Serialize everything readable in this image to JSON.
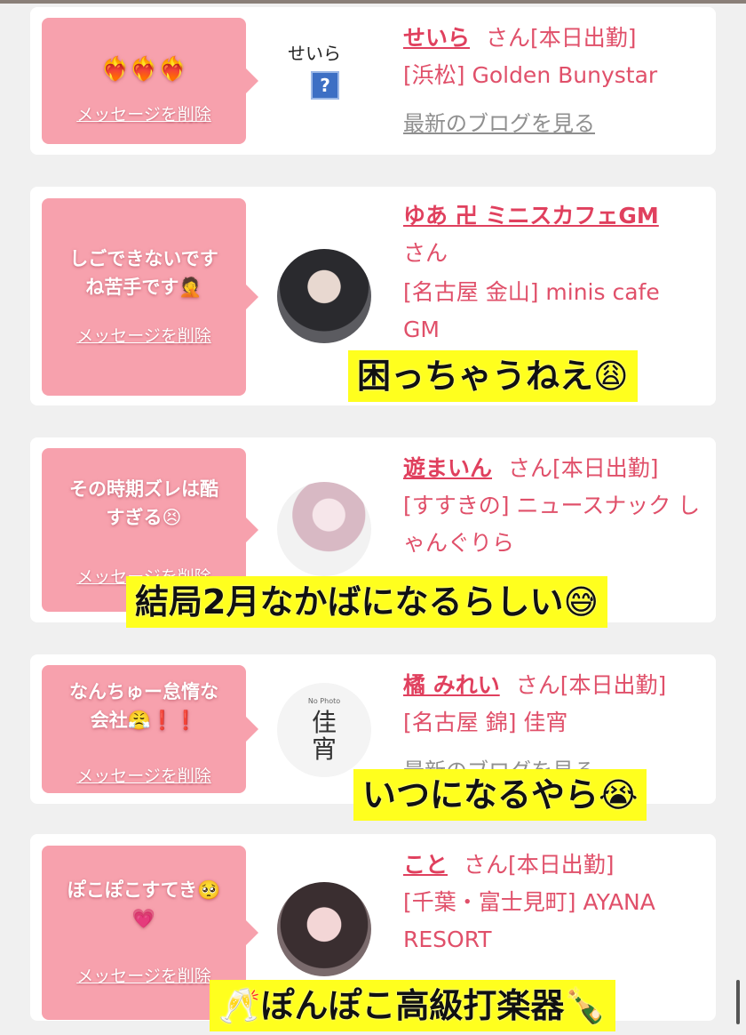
{
  "messages": [
    {
      "text": "❤️‍🔥❤️‍🔥❤️‍🔥",
      "delete_label": "メッセージを削除",
      "avatar_alt": "せいら",
      "name": "せいら",
      "suffix": "さん[本日出勤]",
      "shop": "[浜松] Golden Bunystar",
      "blog": "最新のブログを見る"
    },
    {
      "text": "しごできないです\nね苦手です🤦",
      "delete_label": "メッセージを削除",
      "name": "ゆあ 卍 ミニスカフェGM",
      "suffix": "さん",
      "shop": "[名古屋 金山] minis cafe GM"
    },
    {
      "text": "その時期ズレは酷\nすぎる😣",
      "delete_label": "メッセージを削除",
      "name": "遊まいん",
      "suffix": "さん[本日出勤]",
      "shop": "[すすきの] ニュースナック しゃんぐりら"
    },
    {
      "text": "なんちゅー怠惰な\n会社😤❗❗",
      "delete_label": "メッセージを削除",
      "avatar_text": "佳宵",
      "avatar_small": "No Photo",
      "name": "橘 みれい",
      "suffix": "さん[本日出勤]",
      "shop": "[名古屋 錦] 佳宵",
      "blog": "最新のブログを見る"
    },
    {
      "text": "ぽこぽこすてき🥺\n💗",
      "delete_label": "メッセージを削除",
      "name": "こと",
      "suffix": "さん[本日出勤]",
      "shop": "[千葉・富士見町] AYANA RESORT"
    }
  ],
  "captions": [
    "困っちゃうねえ😩",
    "結局2月なかばになるらしい😅",
    "いつになるやら😭",
    "🥂ぽんぽこ高級打楽器🍾"
  ],
  "colors": {
    "bubble": "#f7a1ad",
    "link": "#e0405e",
    "caption_bg": "#ffff1e"
  }
}
